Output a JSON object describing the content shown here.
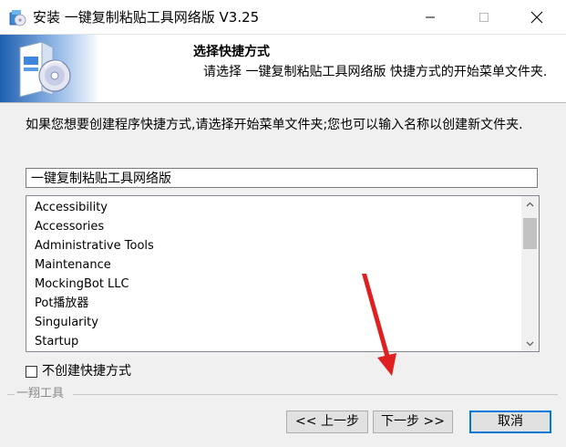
{
  "window": {
    "title": "安装 一键复制粘贴工具网络版 V3.25",
    "app_icon": "installer-icon",
    "controls": {
      "minimize": "minimize-icon",
      "maximize": "maximize-icon",
      "close": "close-icon"
    }
  },
  "header": {
    "title": "选择快捷方式",
    "subtitle": "请选择 一键复制粘贴工具网络版 快捷方式的开始菜单文件夹.",
    "art": "software-box-cd-icon"
  },
  "body": {
    "description": "如果您想要创建程序快捷方式,请选择开始菜单文件夹;您也可以输入名称以创建新文件夹.",
    "folder_value": "一键复制粘贴工具网络版",
    "folders": [
      "Accessibility",
      "Accessories",
      "Administrative Tools",
      "Maintenance",
      "MockingBot LLC",
      "Pot播放器",
      "Singularity",
      "Startup"
    ],
    "no_shortcut_label": "不创建快捷方式",
    "no_shortcut_checked": false
  },
  "footer": {
    "brand": "一翔工具",
    "back_label": "<< 上一步",
    "next_label": "下一步 >>",
    "cancel_label": "取消"
  },
  "annotation": {
    "color": "#e02020",
    "icon": "red-arrow"
  }
}
